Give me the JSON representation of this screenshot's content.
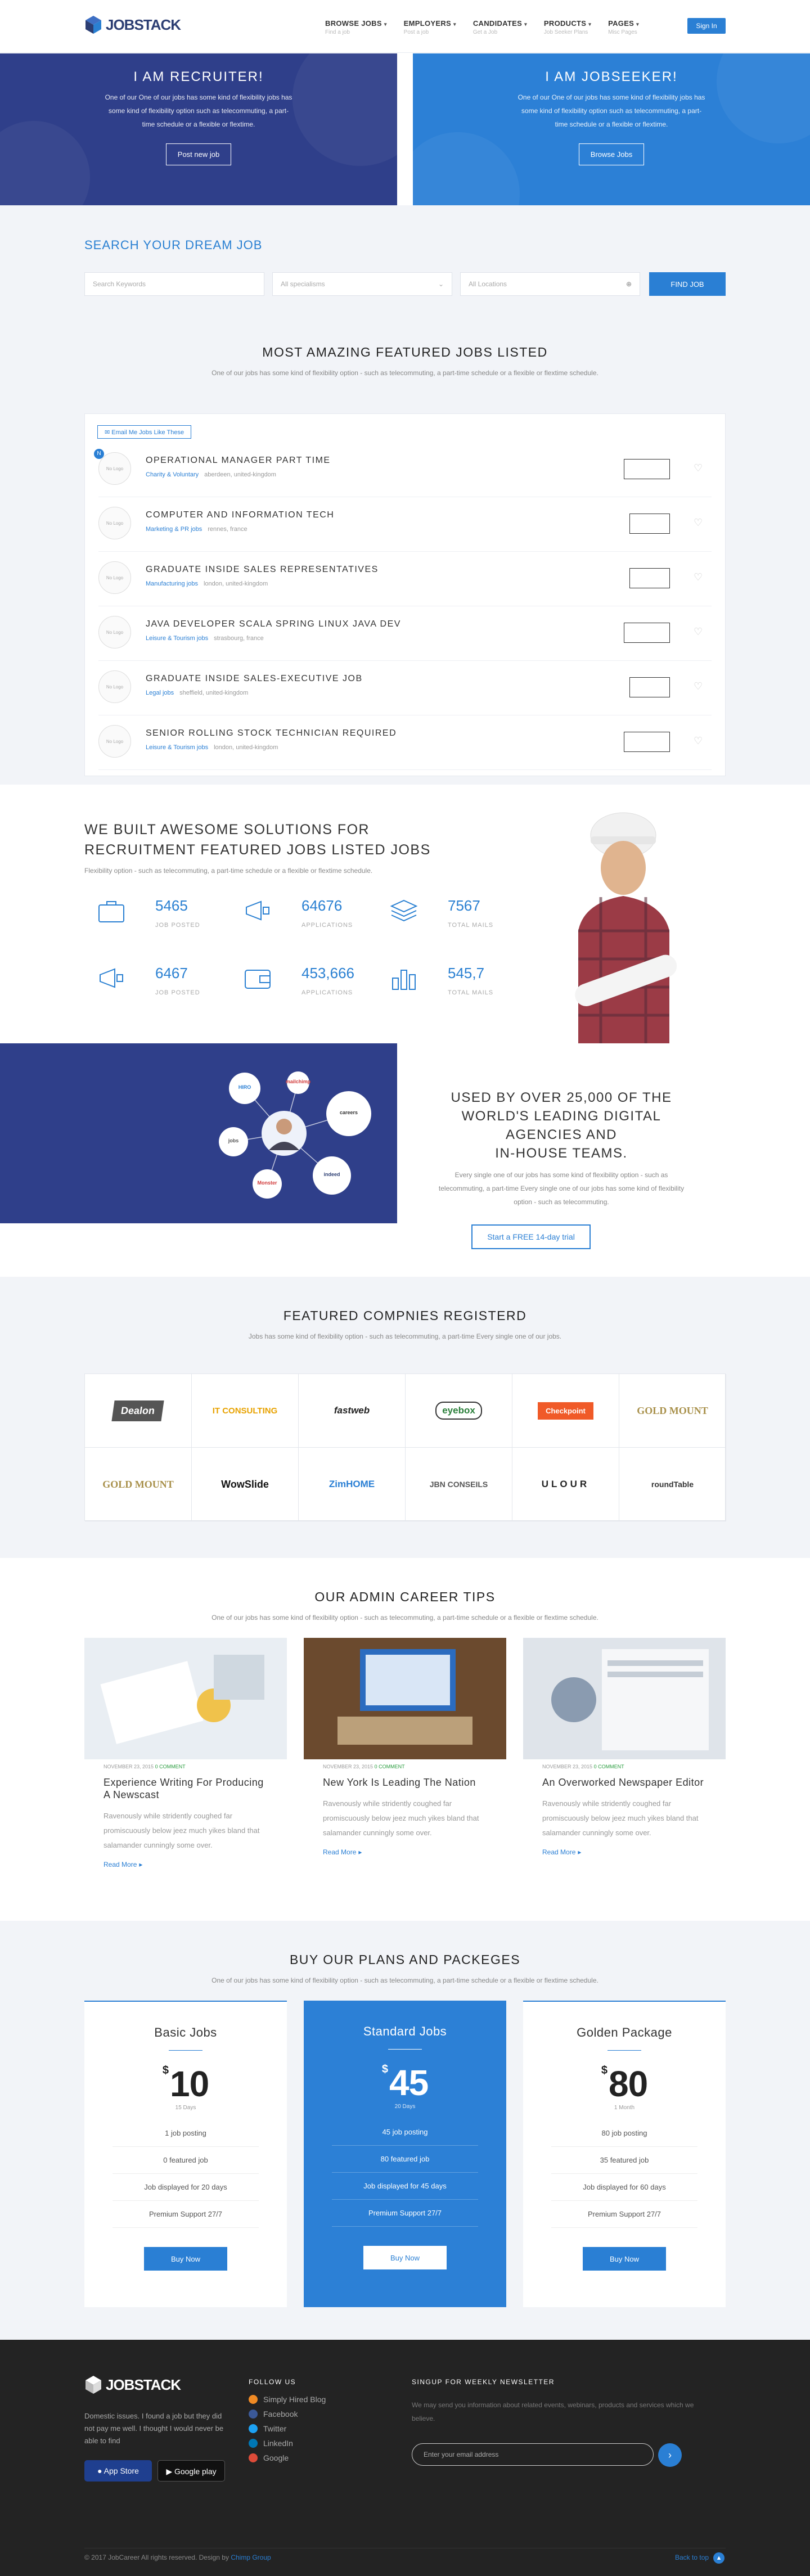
{
  "header": {
    "brand": "JOBSTACK",
    "nav": [
      {
        "label": "BROWSE JOBS",
        "sub": "Find a job"
      },
      {
        "label": "EMPLOYERS",
        "sub": "Post a job"
      },
      {
        "label": "CANDIDATES",
        "sub": "Get a Job"
      },
      {
        "label": "PRODUCTS",
        "sub": "Job Seeker Plans"
      },
      {
        "label": "PAGES",
        "sub": "Misc Pages"
      }
    ],
    "signin": "Sign In"
  },
  "hero": {
    "left": {
      "title": "I AM RECRUITER!",
      "text": "One of our One of our jobs has some kind of flexibility jobs has some kind of flexibility option such as telecommuting, a part-time schedule or a flexible or flextime.",
      "button": "Post new job"
    },
    "right": {
      "title": "I AM JOBSEEKER!",
      "text": "One of our One of our jobs has some kind of flexibility jobs has some kind of flexibility option such as telecommuting, a part-time schedule or a flexible or flextime.",
      "button": "Browse Jobs"
    }
  },
  "search": {
    "title": "SEARCH YOUR DREAM JOB",
    "keywords_placeholder": "Search Keywords",
    "specialisms": "All specialisms",
    "locations": "All Locations",
    "button": "FIND JOB"
  },
  "featured": {
    "title": "MOST AMAZING FEATURED JOBS LISTED",
    "subtitle": "One of our jobs has some kind of flexibility option - such as telecommuting, a part-time schedule or a flexible or flextime schedule.",
    "email_button": "Email Me Jobs Like These",
    "new_badge": "N",
    "avatar_text": "No Logo",
    "jobs": [
      {
        "title": "OPERATIONAL MANAGER PART TIME",
        "category": "Charity & Voluntary",
        "location": "aberdeen, united-kingdom"
      },
      {
        "title": "COMPUTER AND INFORMATION TECH",
        "category": "Marketing & PR jobs",
        "location": "rennes, france"
      },
      {
        "title": "GRADUATE INSIDE SALES REPRESENTATIVES",
        "category": "Manufacturing jobs",
        "location": "london, united-kingdom"
      },
      {
        "title": "JAVA DEVELOPER SCALA SPRING LINUX JAVA DEV",
        "category": "Leisure & Tourism jobs",
        "location": "strasbourg, france"
      },
      {
        "title": "GRADUATE INSIDE SALES-EXECUTIVE JOB",
        "category": "Legal jobs",
        "location": "sheffield, united-kingdom"
      },
      {
        "title": "SENIOR ROLLING STOCK TECHNICIAN REQUIRED",
        "category": "Leisure & Tourism jobs",
        "location": "london, united-kingdom"
      }
    ]
  },
  "solutions": {
    "title_line1": "WE BUILT AWESOME SOLUTIONS FOR",
    "title_line2": "RECRUITMENT FEATURED JOBS LISTED JOBS",
    "subtitle": "Flexibility option - such as telecommuting, a part-time schedule or a flexible or flextime schedule.",
    "stats": [
      {
        "value": "5465",
        "label": "JOB POSTED",
        "icon": "briefcase-icon"
      },
      {
        "value": "64676",
        "label": "APPLICATIONS",
        "icon": "megaphone-icon"
      },
      {
        "value": "7567",
        "label": "TOTAL MAILS",
        "icon": "layers-icon"
      },
      {
        "value": "6467",
        "label": "JOB POSTED",
        "icon": "megaphone-icon"
      },
      {
        "value": "453,666",
        "label": "APPLICATIONS",
        "icon": "wallet-icon"
      },
      {
        "value": "545,7",
        "label": "TOTAL MAILS",
        "icon": "bar-chart-icon"
      }
    ]
  },
  "leading": {
    "title_line1": "USED BY OVER 25,000 OF THE",
    "title_line2": "WORLD'S LEADING DIGITAL",
    "title_line3": "AGENCIES AND",
    "title_line4": "IN-HOUSE TEAMS.",
    "text": "Every single one of our jobs has some kind of flexibility option - such as telecommuting, a part-time Every single one of our jobs has some kind of flexibility option - such as telecommuting.",
    "button": "Start a FREE 14-day trial",
    "network": [
      "HIRO",
      "mailchimp",
      "careers",
      "jobs",
      "Monster",
      "indeed"
    ]
  },
  "companies": {
    "title": "FEATURED COMPNIES REGISTERD",
    "subtitle": "Jobs has some kind of flexibility option - such as telecommuting, a part-time Every single one of our jobs.",
    "logos": [
      "Dealon",
      "IT CONSULTING",
      "fastweb",
      "eyebox",
      "Checkpoint",
      "GOLD MOUNT",
      "GOLD MOUNT",
      "WowSlide",
      "ZimHOME",
      "JBN CONSEILS",
      "ULOUR",
      "roundTable"
    ]
  },
  "tips": {
    "title": "OUR ADMIN CAREER TIPS",
    "subtitle": "One of our jobs has some kind of flexibility option - such as telecommuting, a part-time schedule or a flexible or flextime schedule.",
    "posts": [
      {
        "date": "NOVEMBER 23, 2015",
        "comments": "0 COMMENT",
        "title": "Experience Writing For Producing A Newscast",
        "text": "Ravenously while stridently coughed far promiscuously below jeez much yikes bland that salamander cunningly some over.",
        "more": "Read More"
      },
      {
        "date": "NOVEMBER 23, 2015",
        "comments": "0 COMMENT",
        "title": "New York Is Leading The Nation",
        "text": "Ravenously while stridently coughed far promiscuously below jeez much yikes bland that salamander cunningly some over.",
        "more": "Read More"
      },
      {
        "date": "NOVEMBER 23, 2015",
        "comments": "0 COMMENT",
        "title": "An Overworked Newspaper Editor",
        "text": "Ravenously while stridently coughed far promiscuously below jeez much yikes bland that salamander cunningly some over.",
        "more": "Read More"
      }
    ]
  },
  "plans": {
    "title": "BUY OUR PLANS AND PACKEGES",
    "subtitle": "One of our jobs has some kind of flexibility option - such as telecommuting, a part-time schedule or a flexible or flextime schedule.",
    "items": [
      {
        "name": "Basic Jobs",
        "currency": "$",
        "price": "10",
        "period": "15 Days",
        "features": [
          "1 job posting",
          "0 featured job",
          "Job displayed for 20 days",
          "Premium Support 27/7"
        ],
        "button": "Buy Now"
      },
      {
        "name": "Standard Jobs",
        "currency": "$",
        "price": "45",
        "period": "20 Days",
        "features": [
          "45 job posting",
          "80 featured job",
          "Job displayed for 45 days",
          "Premium Support 27/7"
        ],
        "button": "Buy Now"
      },
      {
        "name": "Golden Package",
        "currency": "$",
        "price": "80",
        "period": "1 Month",
        "features": [
          "80 job posting",
          "35 featured job",
          "Job displayed for 60 days",
          "Premium Support 27/7"
        ],
        "button": "Buy Now"
      }
    ]
  },
  "footer": {
    "brand": "JOBSTACK",
    "description": "Domestic issues. I found a job but they did not pay me well. I thought I would never be able to find",
    "appstore": "App Store",
    "googleplay": "Google play",
    "follow_title": "FOLLOW US",
    "links": [
      "Simply Hired Blog",
      "Facebook",
      "Twitter",
      "LinkedIn",
      "Google"
    ],
    "newsletter_title": "SINGUP FOR WEEKLY NEWSLETTER",
    "newsletter_text": "We may send you information about related events, webinars, products and services which we believe.",
    "email_placeholder": "Enter your email address",
    "copyright": "© 2017 JobCareer All rights reserved. Design by",
    "designer": "Chimp Group",
    "back_to_top": "Back to top"
  },
  "colors": {
    "accent": "#2a7fd4",
    "navy": "#2f3f8a",
    "footer": "#232323"
  }
}
